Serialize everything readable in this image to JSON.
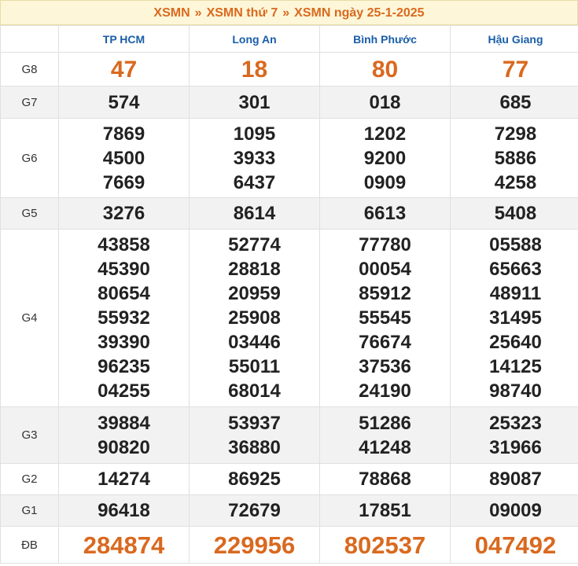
{
  "breadcrumb": {
    "items": [
      "XSMN",
      "XSMN thứ 7",
      "XSMN ngày 25-1-2025"
    ],
    "separator": "»"
  },
  "columns": [
    "TP HCM",
    "Long An",
    "Bình Phước",
    "Hậu Giang"
  ],
  "rows": [
    {
      "label": "G8",
      "values": [
        [
          "47"
        ],
        [
          "18"
        ],
        [
          "80"
        ],
        [
          "77"
        ]
      ]
    },
    {
      "label": "G7",
      "values": [
        [
          "574"
        ],
        [
          "301"
        ],
        [
          "018"
        ],
        [
          "685"
        ]
      ]
    },
    {
      "label": "G6",
      "values": [
        [
          "7869",
          "4500",
          "7669"
        ],
        [
          "1095",
          "3933",
          "6437"
        ],
        [
          "1202",
          "9200",
          "0909"
        ],
        [
          "7298",
          "5886",
          "4258"
        ]
      ]
    },
    {
      "label": "G5",
      "values": [
        [
          "3276"
        ],
        [
          "8614"
        ],
        [
          "6613"
        ],
        [
          "5408"
        ]
      ]
    },
    {
      "label": "G4",
      "values": [
        [
          "43858",
          "45390",
          "80654",
          "55932",
          "39390",
          "96235",
          "04255"
        ],
        [
          "52774",
          "28818",
          "20959",
          "25908",
          "03446",
          "55011",
          "68014"
        ],
        [
          "77780",
          "00054",
          "85912",
          "55545",
          "76674",
          "37536",
          "24190"
        ],
        [
          "05588",
          "65663",
          "48911",
          "31495",
          "25640",
          "14125",
          "98740"
        ]
      ]
    },
    {
      "label": "G3",
      "values": [
        [
          "39884",
          "90820"
        ],
        [
          "53937",
          "36880"
        ],
        [
          "51286",
          "41248"
        ],
        [
          "25323",
          "31966"
        ]
      ]
    },
    {
      "label": "G2",
      "values": [
        [
          "14274"
        ],
        [
          "86925"
        ],
        [
          "78868"
        ],
        [
          "89087"
        ]
      ]
    },
    {
      "label": "G1",
      "values": [
        [
          "96418"
        ],
        [
          "72679"
        ],
        [
          "17851"
        ],
        [
          "09009"
        ]
      ]
    },
    {
      "label": "ĐB",
      "values": [
        [
          "284874"
        ],
        [
          "229956"
        ],
        [
          "802537"
        ],
        [
          "047492"
        ]
      ]
    }
  ],
  "colors": {
    "accent": "#d9691f",
    "header_link": "#1a5ea8",
    "title_bg": "#fdf6d8",
    "alt_row_bg": "#f2f2f2"
  }
}
